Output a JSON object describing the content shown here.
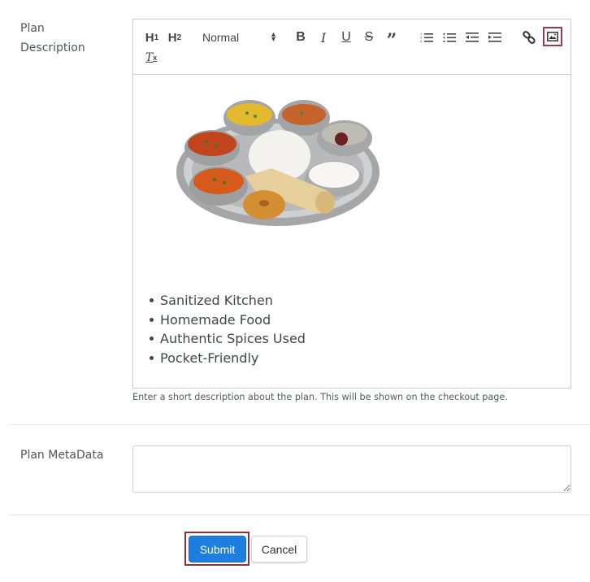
{
  "form": {
    "plan_description_label": "Plan Description",
    "plan_metadata_label": "Plan MetaData",
    "description_help": "Enter a short description about the plan. This will be shown on the checkout page.",
    "metadata_value": ""
  },
  "toolbar": {
    "h1": "H",
    "h1_sub": "1",
    "h2": "H",
    "h2_sub": "2",
    "font_size_selected": "Normal",
    "bold": "B",
    "italic": "I",
    "underline": "U",
    "strike": "S",
    "quote": "”",
    "clear_format": "T",
    "clear_format_sub": "x",
    "icons": [
      "header-1",
      "header-2",
      "size-select",
      "bold",
      "italic",
      "underline",
      "strike",
      "blockquote",
      "ordered-list",
      "bullet-list",
      "outdent",
      "indent",
      "link",
      "image",
      "clean"
    ],
    "highlight_color": "#a23a46"
  },
  "editor_content": {
    "image_alt": "Indian thali plate with curries, rice, roti, vada and curd",
    "bullets": [
      "Sanitized Kitchen",
      "Homemade Food",
      "Authentic Spices Used",
      "Pocket-Friendly"
    ]
  },
  "buttons": {
    "submit": "Submit",
    "cancel": "Cancel",
    "submit_color": "#1e7ee0"
  }
}
